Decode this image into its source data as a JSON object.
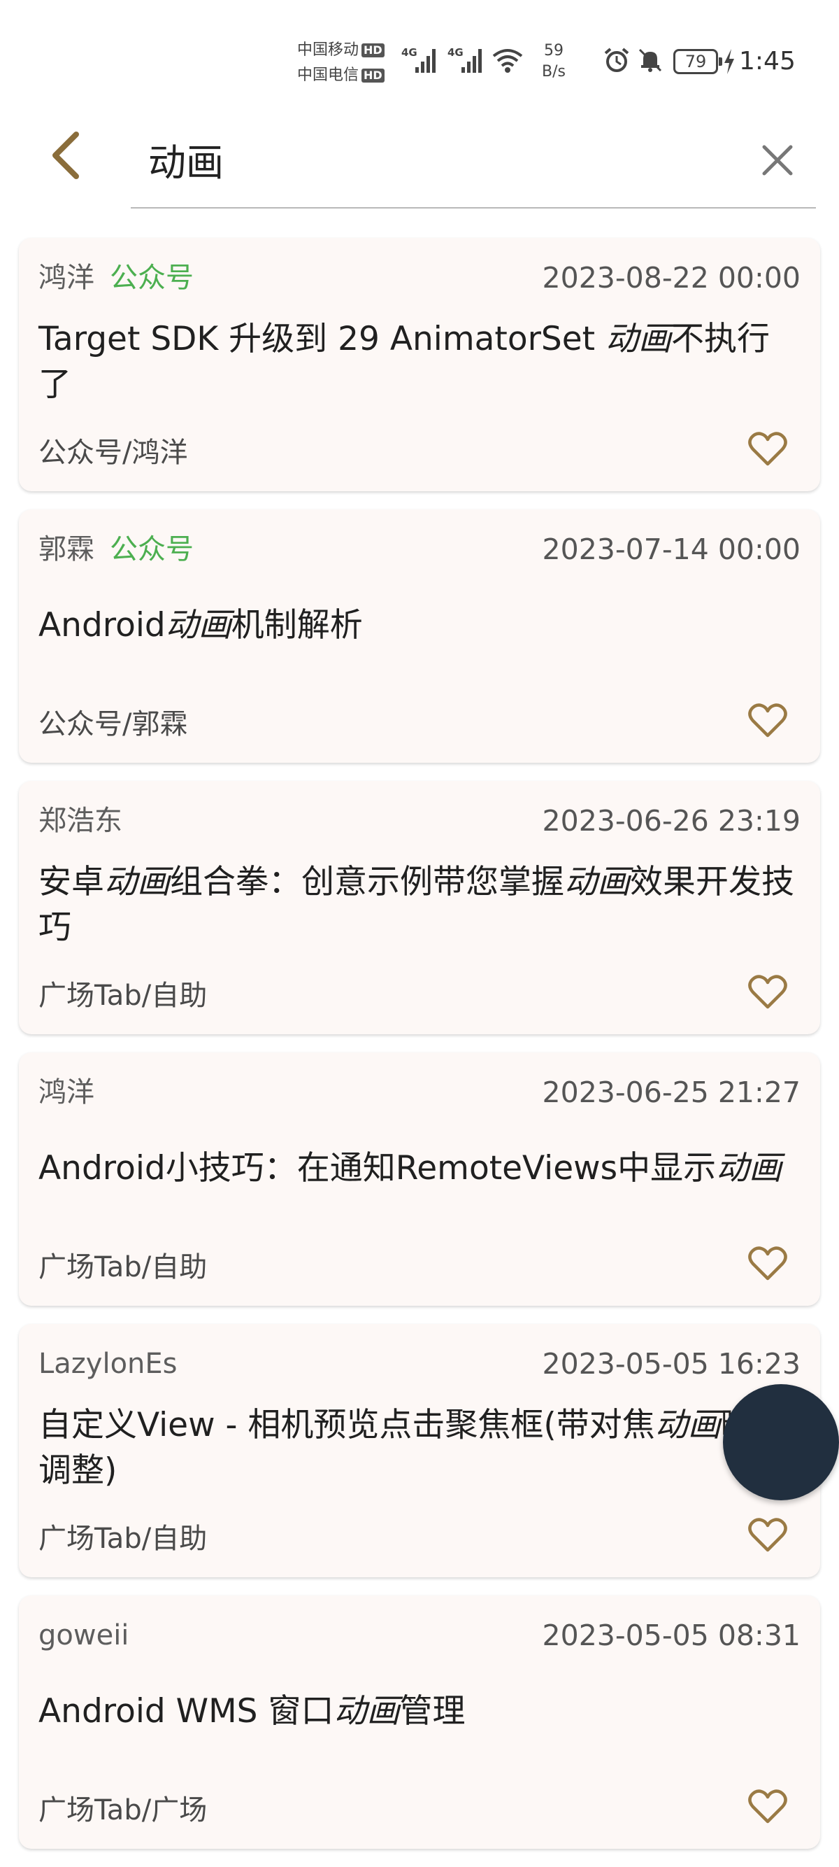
{
  "status_bar": {
    "carrier1": "中国移动",
    "carrier2": "中国电信",
    "hd_badge": "HD",
    "network1": "4G",
    "network2": "4G",
    "speed_value": "59",
    "speed_unit": "B/s",
    "battery": "79",
    "time": "1:45"
  },
  "search": {
    "query": "动画",
    "placeholder": ""
  },
  "colors": {
    "accent": "#8a6d3b",
    "tag_green": "#4caf50",
    "card_bg": "#fdf8f6",
    "fab": "#212f3f"
  },
  "articles": [
    {
      "author": "鸿洋",
      "tag": "公众号",
      "date": "2023-08-22 00:00",
      "title_parts": [
        "Target SDK 升级到 29 AnimatorSet ",
        "动画",
        "不执行了",
        ""
      ],
      "chapter": "公众号/鸿洋",
      "fav_icon": "heart-outline-icon"
    },
    {
      "author": "郭霖",
      "tag": "公众号",
      "date": "2023-07-14 00:00",
      "title_parts": [
        "Android",
        "动画",
        "机制解析",
        ""
      ],
      "chapter": "公众号/郭霖",
      "fav_icon": "heart-outline-icon"
    },
    {
      "author": "郑浩东",
      "tag": "",
      "date": "2023-06-26 23:19",
      "title_parts": [
        "安卓",
        "动画",
        "组合拳：创意示例带您掌握",
        "动画",
        "效果开发技巧"
      ],
      "chapter": "广场Tab/自助",
      "fav_icon": "heart-outline-icon"
    },
    {
      "author": "鸿洋",
      "tag": "",
      "date": "2023-06-25 21:27",
      "title_parts": [
        "Android小技巧：在通知RemoteViews中显示",
        "动画",
        "",
        ""
      ],
      "chapter": "广场Tab/自助",
      "fav_icon": "heart-outline-icon"
    },
    {
      "author": "LazylonEs",
      "tag": "",
      "date": "2023-05-05 16:23",
      "title_parts": [
        "自定义View - 相机预览点击聚焦框(带对焦",
        "动画",
        "曝光调整)",
        ""
      ],
      "chapter": "广场Tab/自助",
      "fav_icon": "heart-outline-icon"
    },
    {
      "author": "goweii",
      "tag": "",
      "date": "2023-05-05 08:31",
      "title_parts": [
        "Android WMS 窗口",
        "动画",
        "管理",
        ""
      ],
      "chapter": "广场Tab/广场",
      "fav_icon": "heart-outline-icon"
    }
  ]
}
